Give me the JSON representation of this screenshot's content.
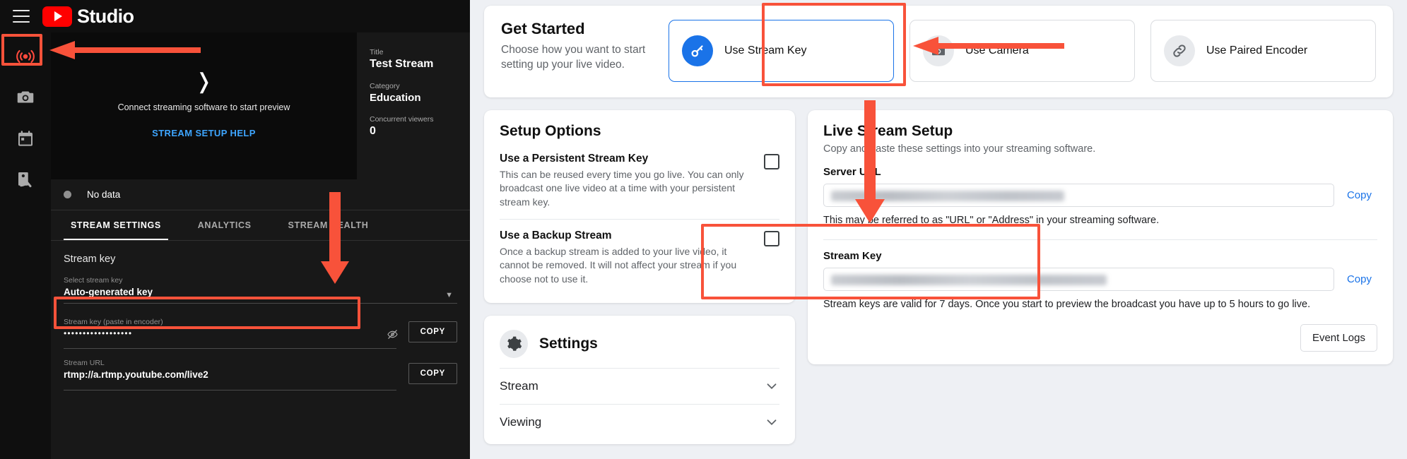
{
  "studio": {
    "brand": "Studio",
    "menu_icon": "hamburger-icon",
    "rail": [
      {
        "name": "stream-icon",
        "label": "Stream"
      },
      {
        "name": "webcam-icon",
        "label": "Webcam"
      },
      {
        "name": "manage-icon",
        "label": "Manage"
      },
      {
        "name": "analytics-icon",
        "label": "Analytics"
      }
    ],
    "preview": {
      "spinner": "❭",
      "message": "Connect streaming software to start preview",
      "link": "STREAM SETUP HELP"
    },
    "info": {
      "title_label": "Title",
      "title_value": "Test Stream",
      "category_label": "Category",
      "category_value": "Education",
      "viewers_label": "Concurrent viewers",
      "viewers_value": "0"
    },
    "status": {
      "text": "No data"
    },
    "tabs": [
      {
        "label": "STREAM SETTINGS",
        "active": true
      },
      {
        "label": "ANALYTICS",
        "active": false
      },
      {
        "label": "STREAM HEALTH",
        "active": false
      }
    ],
    "stream_key_section": {
      "heading": "Stream key",
      "select_label": "Select stream key",
      "select_value": "Auto-generated key",
      "key_label": "Stream key (paste in encoder)",
      "key_value": "••••••••••••••••••",
      "key_copy": "COPY",
      "url_label": "Stream URL",
      "url_value": "rtmp://a.rtmp.youtube.com/live2",
      "url_copy": "COPY"
    }
  },
  "web": {
    "get_started": {
      "title": "Get Started",
      "subtitle": "Choose how you want to start setting up your live video.",
      "options": [
        {
          "label": "Use Stream Key",
          "icon": "key-icon",
          "selected": true
        },
        {
          "label": "Use Camera",
          "icon": "camera-icon",
          "selected": false
        },
        {
          "label": "Use Paired Encoder",
          "icon": "link-icon",
          "selected": false
        }
      ]
    },
    "setup_options": {
      "title": "Setup Options",
      "items": [
        {
          "heading": "Use a Persistent Stream Key",
          "description": "This can be reused every time you go live. You can only broadcast one live video at a time with your persistent stream key.",
          "checked": false
        },
        {
          "heading": "Use a Backup Stream",
          "description": "Once a backup stream is added to your live video, it cannot be removed. It will not affect your stream if you choose not to use it.",
          "checked": false
        }
      ]
    },
    "settings": {
      "title": "Settings",
      "icon": "gear-icon",
      "rows": [
        {
          "label": "Stream",
          "icon": "chevron-down-icon"
        },
        {
          "label": "Viewing",
          "icon": "chevron-down-icon"
        }
      ]
    },
    "live_stream_setup": {
      "title": "Live Stream Setup",
      "subtitle": "Copy and paste these settings into your streaming software.",
      "server_url_label": "Server URL",
      "server_url_value": "",
      "server_url_copy": "Copy",
      "server_url_help": "This may be referred to as \"URL\" or \"Address\" in your streaming software.",
      "stream_key_label": "Stream Key",
      "stream_key_value": "",
      "stream_key_copy": "Copy",
      "stream_key_help": "Stream keys are valid for 7 days. Once you start to preview the broadcast you have up to 5 hours to go live.",
      "event_logs_button": "Event Logs"
    }
  },
  "annotations": {
    "accent_color": "#f8523a",
    "highlights": [
      {
        "name": "stream-rail-highlight"
      },
      {
        "name": "stream-key-field-highlight"
      },
      {
        "name": "use-stream-key-card-highlight"
      },
      {
        "name": "stream-key-panel-highlight"
      }
    ],
    "arrows": [
      {
        "name": "arrow-to-stream-rail"
      },
      {
        "name": "arrow-to-stream-key-field"
      },
      {
        "name": "arrow-to-use-stream-key-card"
      },
      {
        "name": "arrow-to-stream-key-panel"
      }
    ]
  }
}
